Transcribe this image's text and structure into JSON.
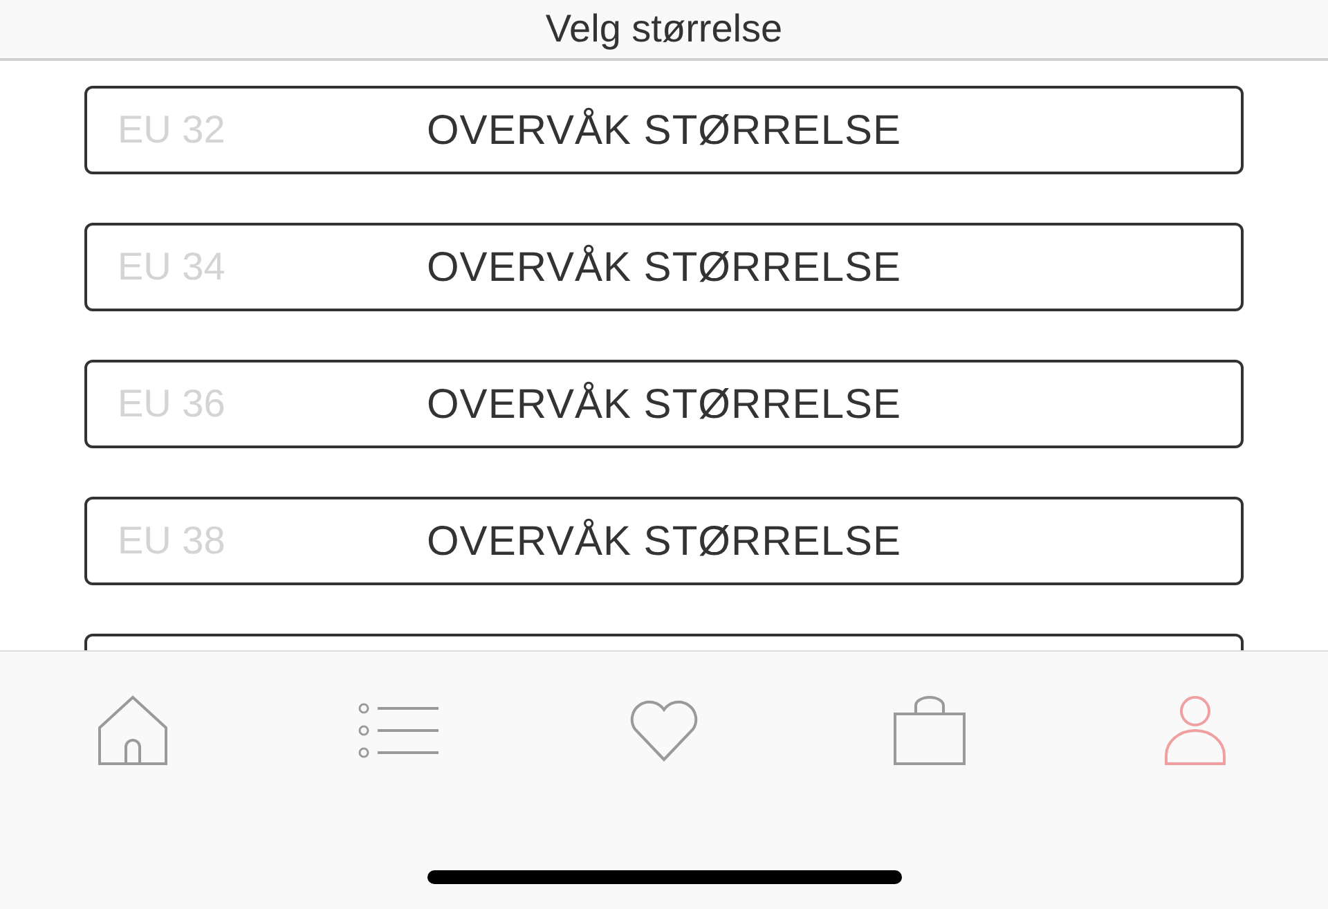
{
  "header": {
    "title": "Velg størrelse"
  },
  "sizes": [
    {
      "size": "EU 32",
      "action": "OVERVÅK STØRRELSE"
    },
    {
      "size": "EU 34",
      "action": "OVERVÅK STØRRELSE"
    },
    {
      "size": "EU 36",
      "action": "OVERVÅK STØRRELSE"
    },
    {
      "size": "EU 38",
      "action": "OVERVÅK STØRRELSE"
    }
  ],
  "tab_bar": [
    {
      "kind": "home",
      "selected": false
    },
    {
      "kind": "list",
      "selected": false
    },
    {
      "kind": "heart",
      "selected": false
    },
    {
      "kind": "bag",
      "selected": false
    },
    {
      "kind": "profile",
      "selected": true
    }
  ]
}
